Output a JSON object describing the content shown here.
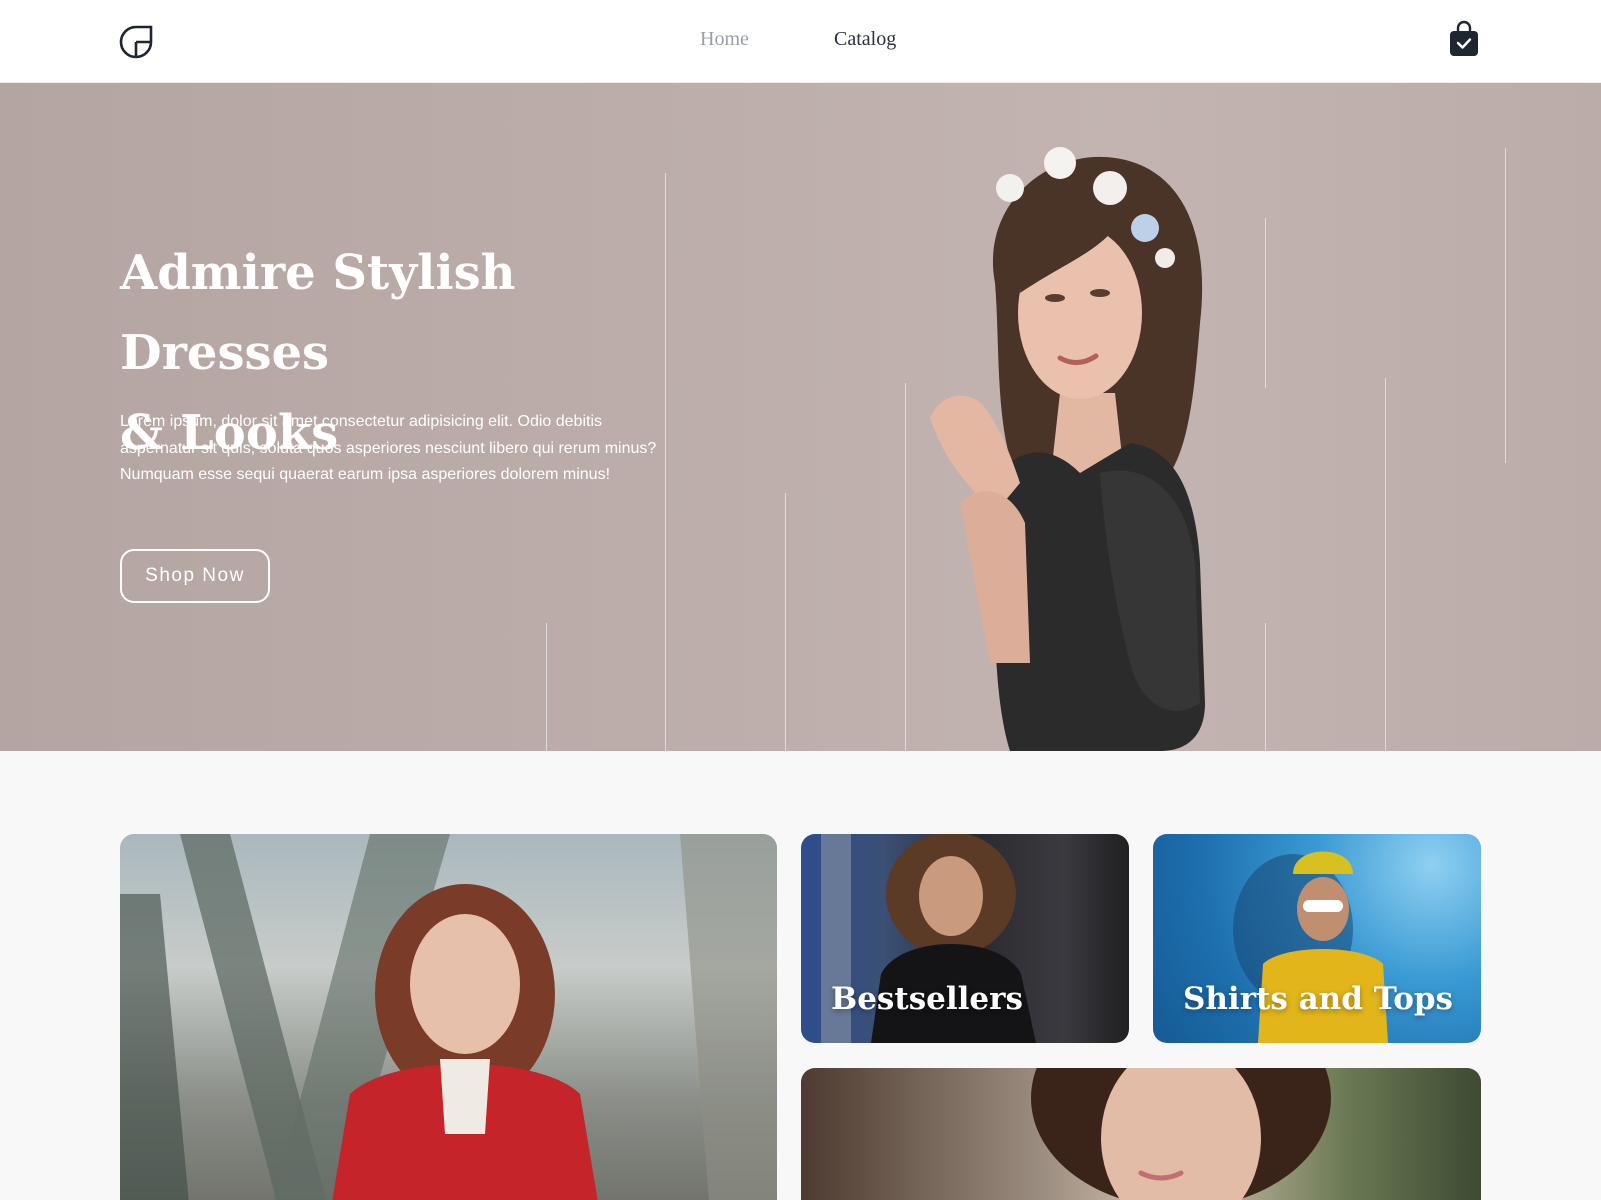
{
  "header": {
    "logo_icon": "leaf-logo-icon",
    "nav": [
      {
        "label": "Home"
      },
      {
        "label": "Catalog"
      }
    ],
    "cart_icon": "shopping-bag-icon"
  },
  "hero": {
    "title_line1": "Admire Stylish Dresses",
    "title_line2": "& Looks",
    "text": "Lorem ipsum, dolor sit amet consectetur adipisicing elit. Odio debitis aspernatur sit quis, soluta quos asperiores nesciunt libero qui rerum minus? Numquam esse sequi quaerat earum ipsa asperiores dolorem minus!",
    "button_label": "Shop Now"
  },
  "categories": {
    "bestsellers_label": "Bestsellers",
    "shirts_label": "Shirts and Tops"
  },
  "colors": {
    "brand_dark": "#1f2533",
    "hero_bg": "#bcaca9",
    "page_bg": "#f8f8f8"
  }
}
